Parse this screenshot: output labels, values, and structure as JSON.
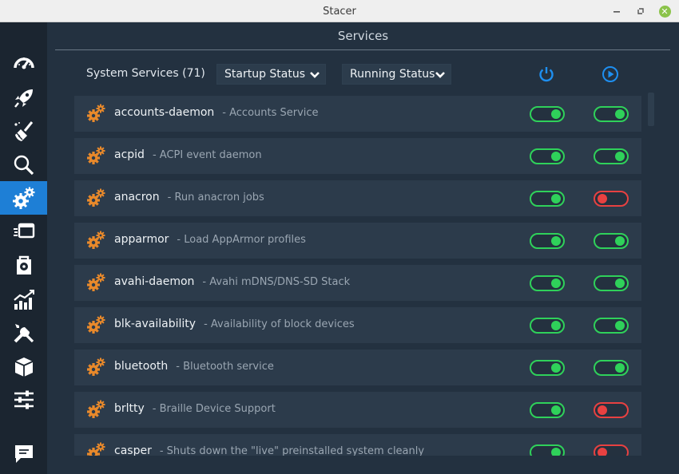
{
  "window": {
    "title": "Stacer"
  },
  "page": {
    "title": "Services"
  },
  "toolbar": {
    "system_services_label": "System Services (71)",
    "startup_status_label": "Startup Status",
    "running_status_label": "Running Status"
  },
  "colors": {
    "accent": "#1e7fd6",
    "on": "#2fd15a",
    "off": "#e84141",
    "gear": "#e8892b"
  },
  "sidebar": {
    "items": [
      {
        "icon": "dashboard-icon"
      },
      {
        "icon": "rocket-icon"
      },
      {
        "icon": "broom-icon"
      },
      {
        "icon": "search-icon"
      },
      {
        "icon": "gears-icon",
        "active": true
      },
      {
        "icon": "processes-icon"
      },
      {
        "icon": "uninstaller-icon"
      },
      {
        "icon": "resources-icon"
      },
      {
        "icon": "tools-icon"
      },
      {
        "icon": "package-icon"
      },
      {
        "icon": "settings-sliders-icon"
      },
      {
        "icon": "feedback-icon"
      }
    ]
  },
  "services": [
    {
      "name": "accounts-daemon",
      "desc": "- Accounts Service",
      "startup": true,
      "running": true
    },
    {
      "name": "acpid",
      "desc": "- ACPI event daemon",
      "startup": true,
      "running": true
    },
    {
      "name": "anacron",
      "desc": "- Run anacron jobs",
      "startup": true,
      "running": false
    },
    {
      "name": "apparmor",
      "desc": "- Load AppArmor profiles",
      "startup": true,
      "running": true
    },
    {
      "name": "avahi-daemon",
      "desc": "- Avahi mDNS/DNS-SD Stack",
      "startup": true,
      "running": true
    },
    {
      "name": "blk-availability",
      "desc": "- Availability of block devices",
      "startup": true,
      "running": true
    },
    {
      "name": "bluetooth",
      "desc": "- Bluetooth service",
      "startup": true,
      "running": true
    },
    {
      "name": "brltty",
      "desc": "- Braille Device Support",
      "startup": true,
      "running": false
    },
    {
      "name": "casper",
      "desc": "- Shuts down the \"live\" preinstalled system cleanly",
      "startup": true,
      "running": false
    }
  ]
}
